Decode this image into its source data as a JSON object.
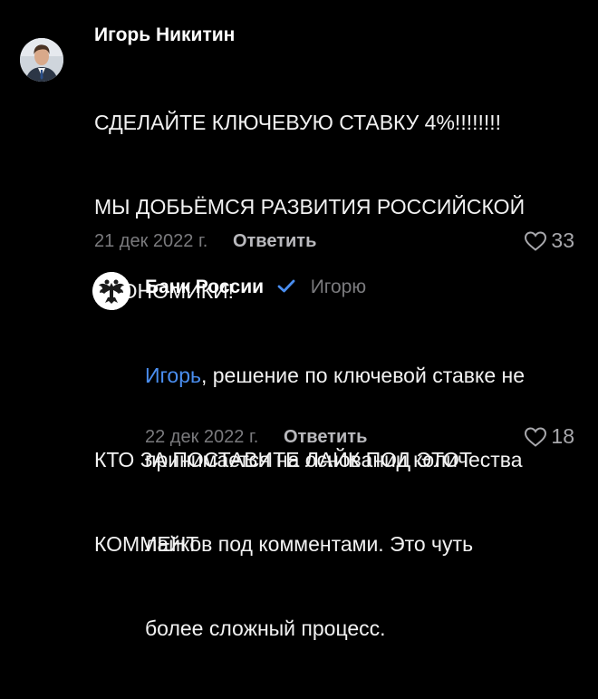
{
  "comment": {
    "author": "Игорь Никитин",
    "lines": [
      "СДЕЛАЙТЕ КЛЮЧЕВУЮ СТАВКУ 4%!!!!!!!!",
      "МЫ ДОБЬЁМСЯ РАЗВИТИЯ РОССИЙСКОЙ",
      "ЭКОНОМИКИ!",
      "",
      "КТО ЗА ПОСТАВИТЕ ЛАЙК ПОД ЭТОТ",
      "КОММЕНТ"
    ],
    "date": "21 дек 2022 г.",
    "reply_label": "Ответить",
    "likes": "33"
  },
  "reply": {
    "author": "Банк России",
    "reply_to": "Игорю",
    "mention": "Игорь",
    "line1_rest": ", решение по ключевой ставке не",
    "lines": [
      "принимается на основании количества",
      "лайков под комментами. Это чуть",
      "более сложный процесс."
    ],
    "date": "22 дек 2022 г.",
    "reply_label": "Ответить",
    "likes": "18"
  },
  "colors": {
    "background": "#000000",
    "mention": "#4a8ef0",
    "verified": "#4a8ef0",
    "muted": "#7a7a7d"
  },
  "icons": {
    "verified": "verified-check-icon",
    "like": "heart-icon",
    "bank_logo": "double-headed-eagle-icon"
  }
}
